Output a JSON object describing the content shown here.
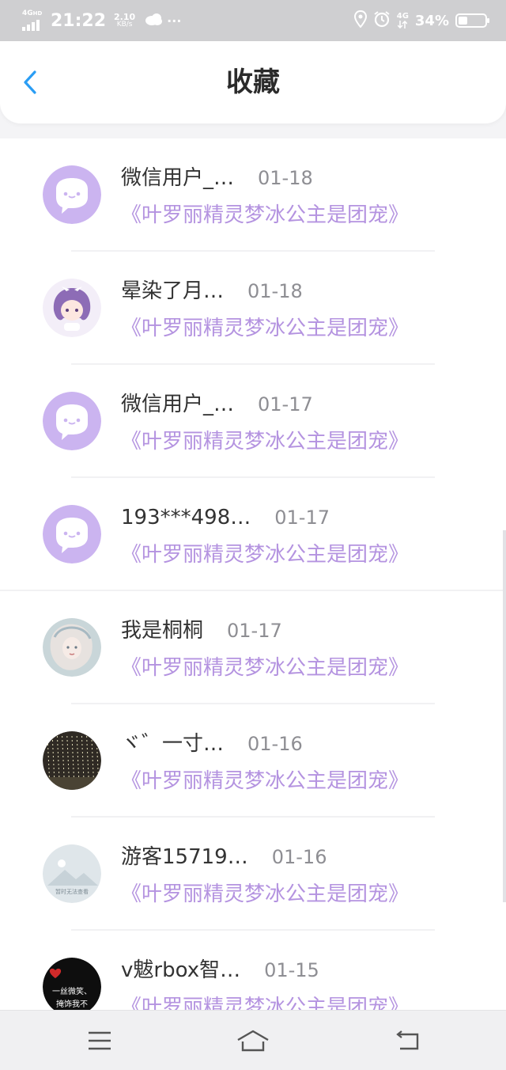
{
  "status_bar": {
    "network_label": "4G",
    "network_sub": "HD",
    "time": "21:22",
    "speed_value": "2.10",
    "speed_unit": "KB/s",
    "more": "···",
    "right_network": "4G",
    "battery_percent": "34%",
    "battery_level": 0.34
  },
  "header": {
    "title": "收藏",
    "back_icon": "chevron-left-icon"
  },
  "colors": {
    "accent_blue": "#2a9df4",
    "book_purple": "#b493e0",
    "avatar_purple": "#cbb4f0"
  },
  "favorites": [
    {
      "user": "微信用户_…",
      "date": "01-18",
      "book": "《叶罗丽精灵梦冰公主是团宠》",
      "avatar": "chat-bubble-avatar"
    },
    {
      "user": "晕染了月…",
      "date": "01-18",
      "book": "《叶罗丽精灵梦冰公主是团宠》",
      "avatar": "anime-girl-avatar"
    },
    {
      "user": "微信用户_…",
      "date": "01-17",
      "book": "《叶罗丽精灵梦冰公主是团宠》",
      "avatar": "chat-bubble-avatar"
    },
    {
      "user": "193***498…",
      "date": "01-17",
      "book": "《叶罗丽精灵梦冰公主是团宠》",
      "avatar": "chat-bubble-avatar"
    },
    {
      "user": "我是桐桐",
      "date": "01-17",
      "book": "《叶罗丽精灵梦冰公主是团宠》",
      "avatar": "portrait-avatar"
    },
    {
      "user": "ヾ゛一寸…",
      "date": "01-16",
      "book": "《叶罗丽精灵梦冰公主是团宠》",
      "avatar": "night-lights-avatar"
    },
    {
      "user": "游客15719…",
      "date": "01-16",
      "book": "《叶罗丽精灵梦冰公主是团宠》",
      "avatar": "no-image-avatar"
    },
    {
      "user": "v魃rbox智…",
      "date": "01-15",
      "book": "《叶罗丽精灵梦冰公主是团宠》",
      "avatar": "heart-text-avatar"
    }
  ],
  "avatar_texts": {
    "no_image": "暂时无法查看",
    "heart_line1": "一丝微笑、",
    "heart_line2": "掩饰我不"
  },
  "nav": {
    "menu_icon": "menu-icon",
    "home_icon": "home-icon",
    "back_icon": "return-icon"
  }
}
